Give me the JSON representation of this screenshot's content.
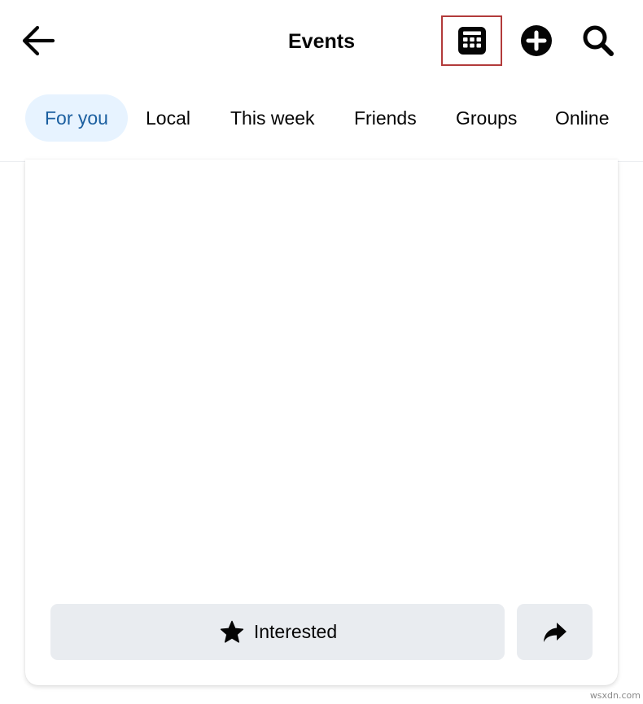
{
  "header": {
    "title": "Events",
    "back_icon": "arrow-left-icon",
    "calendar_icon": "calendar-icon",
    "create_icon": "plus-circle-icon",
    "search_icon": "search-icon",
    "highlight_color": "#b23a3a"
  },
  "tabs": [
    {
      "label": "For you",
      "active": true
    },
    {
      "label": "Local",
      "active": false
    },
    {
      "label": "This week",
      "active": false
    },
    {
      "label": "Friends",
      "active": false
    },
    {
      "label": "Groups",
      "active": false
    },
    {
      "label": "Online",
      "active": false
    }
  ],
  "card": {
    "interested_label": "Interested",
    "interested_icon": "star-icon",
    "share_icon": "share-arrow-icon"
  },
  "watermark": "wsxdn.com",
  "colors": {
    "active_tab_bg": "#e7f3ff",
    "active_tab_text": "#1b5fa0",
    "button_bg": "#e9ecf0",
    "text": "#050505"
  }
}
